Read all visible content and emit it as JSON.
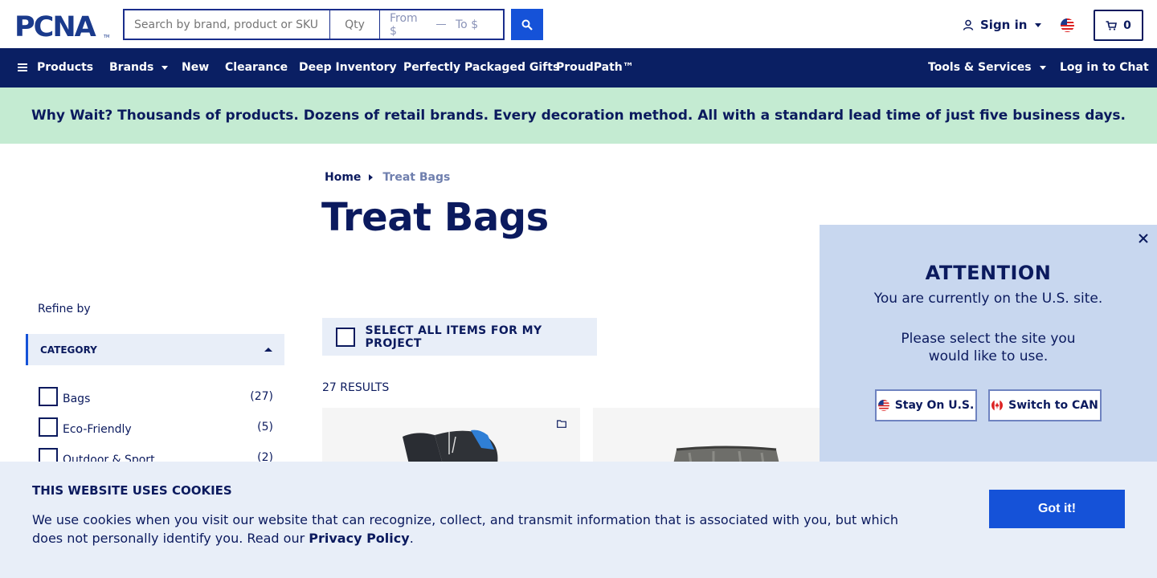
{
  "header": {
    "logo_text": "PCNA",
    "search_placeholder": "Search by brand, product or SKU",
    "qty_placeholder": "Qty",
    "price_from_placeholder": "From $",
    "price_to_placeholder": "To $",
    "sign_in_label": "Sign in",
    "cart_count": "0"
  },
  "nav": {
    "products": "Products",
    "brands": "Brands",
    "new": "New",
    "clearance": "Clearance",
    "deep_inventory": "Deep Inventory",
    "gifts": "Perfectly Packaged Gifts",
    "proudpath": "ProudPath™",
    "tools": "Tools & Services",
    "chat": "Log in to Chat"
  },
  "promo": {
    "text": "Why Wait? Thousands of products. Dozens of retail brands. Every decoration method. All with a standard lead time of just five business days."
  },
  "breadcrumb": {
    "home": "Home",
    "current": "Treat Bags"
  },
  "page_title": "Treat Bags",
  "sidebar": {
    "refine_label": "Refine by",
    "category_header": "CATEGORY",
    "facets": [
      {
        "label": "Bags",
        "count": "(27)"
      },
      {
        "label": "Eco-Friendly",
        "count": "(5)"
      },
      {
        "label": "Outdoor & Sport",
        "count": "(2)"
      }
    ]
  },
  "listing": {
    "select_all_label": "SELECT ALL ITEMS FOR MY PROJECT",
    "results_label": "27 RESULTS"
  },
  "modal": {
    "title": "ATTENTION",
    "subtitle": "You are currently on the U.S. site.",
    "prompt": "Please select the site you would like to use.",
    "stay_label": "Stay On U.S.",
    "switch_label": "Switch to CAN"
  },
  "cookie": {
    "title": "THIS WEBSITE USES COOKIES",
    "text_before": "We use cookies when you visit our website that can recognize, collect, and transmit information that is associated with you, but which does not personally identify you. Read our ",
    "privacy_link": "Privacy Policy",
    "text_after": ".",
    "button_label": "Got it!"
  },
  "colors": {
    "navy": "#0a1f63",
    "primary_blue": "#1552d8",
    "promo_green": "#c4ebd2",
    "light_panel": "#e8eef8",
    "modal_bg": "#c8d7ef"
  }
}
